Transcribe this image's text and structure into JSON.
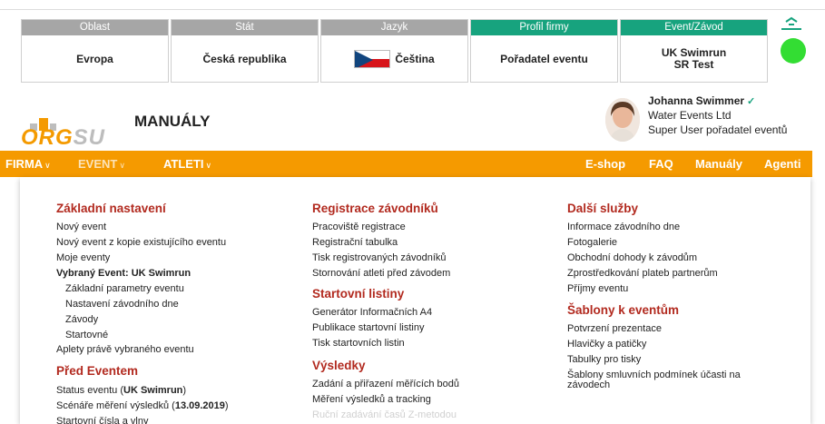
{
  "context_bar": [
    {
      "header": "Oblast",
      "value": "Evropa",
      "header_color": "#a6a6a6"
    },
    {
      "header": "Stát",
      "value": "Česká republika",
      "header_color": "#a6a6a6"
    },
    {
      "header": "Jazyk",
      "value": "Čeština",
      "header_color": "#a6a6a6"
    },
    {
      "header": "Profil firmy",
      "value": "Pořadatel eventu",
      "header_color": "#17a37e"
    },
    {
      "header": "Event/Závod",
      "value_line1": "UK Swimrun",
      "value_line2": "SR Test",
      "header_color": "#17a37e"
    }
  ],
  "status_color": "#33dd33",
  "header": {
    "logo_part1": "ORG",
    "logo_part2": "SU",
    "page_title": "MANUÁLY"
  },
  "user": {
    "name": "Johanna Swimmer",
    "company": "Water Events Ltd",
    "role": "Super User pořadatel eventů"
  },
  "nav": {
    "firma": "FIRMA",
    "event": "EVENT",
    "atleti": "ATLETI",
    "eshop": "E-shop",
    "faq": "FAQ",
    "manualy": "Manuály",
    "agenti": "Agenti"
  },
  "menu": {
    "col1": {
      "title": "Základní nastavení",
      "items": [
        "Nový event",
        "Nový event z kopie existujícího eventu",
        "Moje eventy",
        "Vybraný Event: UK Swimrun",
        "Základní parametry eventu",
        "Nastavení závodního dne",
        "Závody",
        "Startovné",
        "Aplety právě vybraného eventu"
      ],
      "title2": "Před Eventem",
      "status_prefix": "Status eventu (",
      "status_bold": "UK Swimrun",
      "status_suffix": ")",
      "scenar_prefix": "Scénáře měření výsledků (",
      "scenar_bold": "13.09.2019",
      "scenar_suffix": ")",
      "cisla": "Startovní čísla a vlny"
    },
    "col2": {
      "title": "Registrace závodníků",
      "items": [
        "Pracoviště registrace",
        "Registrační tabulka",
        "Tisk registrovaných závodníků",
        "Stornování atleti před závodem"
      ],
      "title2": "Startovní listiny",
      "items2": [
        "Generátor Informačních A4",
        "Publikace startovní listiny",
        "Tisk startovních listin"
      ],
      "title3": "Výsledky",
      "items3": [
        "Zadání a přiřazení měřících bodů",
        "Měření výsledků a tracking",
        "Ruční zadávání časů Z-metodou"
      ]
    },
    "col3": {
      "title": "Další služby",
      "items": [
        "Informace závodního dne",
        "Fotogalerie",
        "Obchodní dohody k závodům",
        "Zprostředkování plateb partnerům",
        "Příjmy eventu"
      ],
      "title2": "Šablony k eventům",
      "items2": [
        "Potvrzení prezentace",
        "Hlavičky a patičky",
        "Tabulky pro tisky",
        "Šablony smluvních podmínek účasti na",
        "závodech"
      ]
    }
  }
}
